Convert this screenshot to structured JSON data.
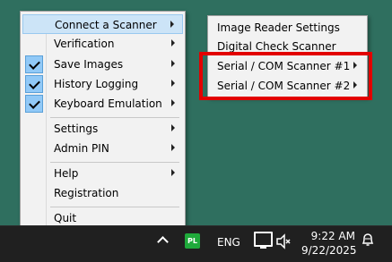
{
  "main_menu": {
    "items": [
      {
        "label": "Connect a Scanner",
        "submenu": true,
        "checked": false,
        "highlighted": true
      },
      {
        "label": "Verification",
        "submenu": true,
        "checked": false
      },
      {
        "label": "Save Images",
        "submenu": true,
        "checked": true
      },
      {
        "label": "History Logging",
        "submenu": true,
        "checked": true
      },
      {
        "label": "Keyboard Emulation",
        "submenu": true,
        "checked": true
      },
      {
        "label": "Settings",
        "submenu": true,
        "checked": false
      },
      {
        "label": "Admin PIN",
        "submenu": true,
        "checked": false
      },
      {
        "label": "Help",
        "submenu": true,
        "checked": false
      },
      {
        "label": "Registration",
        "submenu": false,
        "checked": false
      },
      {
        "label": "Quit",
        "submenu": false,
        "checked": false
      }
    ]
  },
  "sub_menu": {
    "items": [
      {
        "label": "Image Reader Settings",
        "submenu": false
      },
      {
        "label": "Digital Check Scanner",
        "submenu": false
      },
      {
        "label": "Serial / COM Scanner #1",
        "submenu": true
      },
      {
        "label": "Serial / COM Scanner #2",
        "submenu": true
      }
    ]
  },
  "taskbar": {
    "app_icon_text": "PL",
    "language": "ENG",
    "time": "9:22 AM",
    "date": "9/22/2025"
  },
  "colors": {
    "highlight": "#cce4f7",
    "check_bg": "#91c9f7",
    "annotation_box": "#e20000",
    "pl_icon": "#1faa3b"
  }
}
